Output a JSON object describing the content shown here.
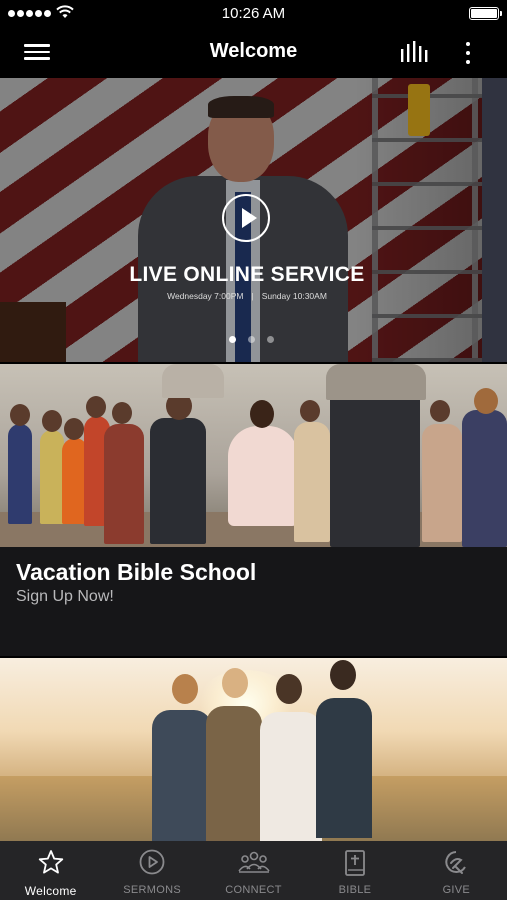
{
  "status_bar": {
    "time": "10:26 AM"
  },
  "navbar": {
    "title": "Welcome",
    "menu_icon": "hamburger-menu-icon",
    "audio_icon": "equalizer-bars-icon",
    "more_icon": "vertical-ellipsis-icon"
  },
  "hero": {
    "title": "LIVE ONLINE SERVICE",
    "time_1": "Wednesday 7:00PM",
    "separator": "|",
    "time_2": "Sunday 10:30AM",
    "play_icon": "play-circle-icon",
    "slide_count": 3,
    "active_slide": 1
  },
  "cards": [
    {
      "title": "Vacation Bible School",
      "subtitle": "Sign Up Now!"
    }
  ],
  "tabs": [
    {
      "label": "Welcome",
      "icon": "star-icon",
      "active": true
    },
    {
      "label": "SERMONS",
      "icon": "play-circle-icon",
      "active": false
    },
    {
      "label": "CONNECT",
      "icon": "people-group-icon",
      "active": false
    },
    {
      "label": "BIBLE",
      "icon": "bible-icon",
      "active": false
    },
    {
      "label": "GIVE",
      "icon": "give-hand-icon",
      "active": false
    }
  ],
  "colors": {
    "background": "#000000",
    "tabbar": "#252527",
    "card": "#161618",
    "tab_inactive": "#8a8a8d",
    "tab_active": "#ffffff"
  }
}
